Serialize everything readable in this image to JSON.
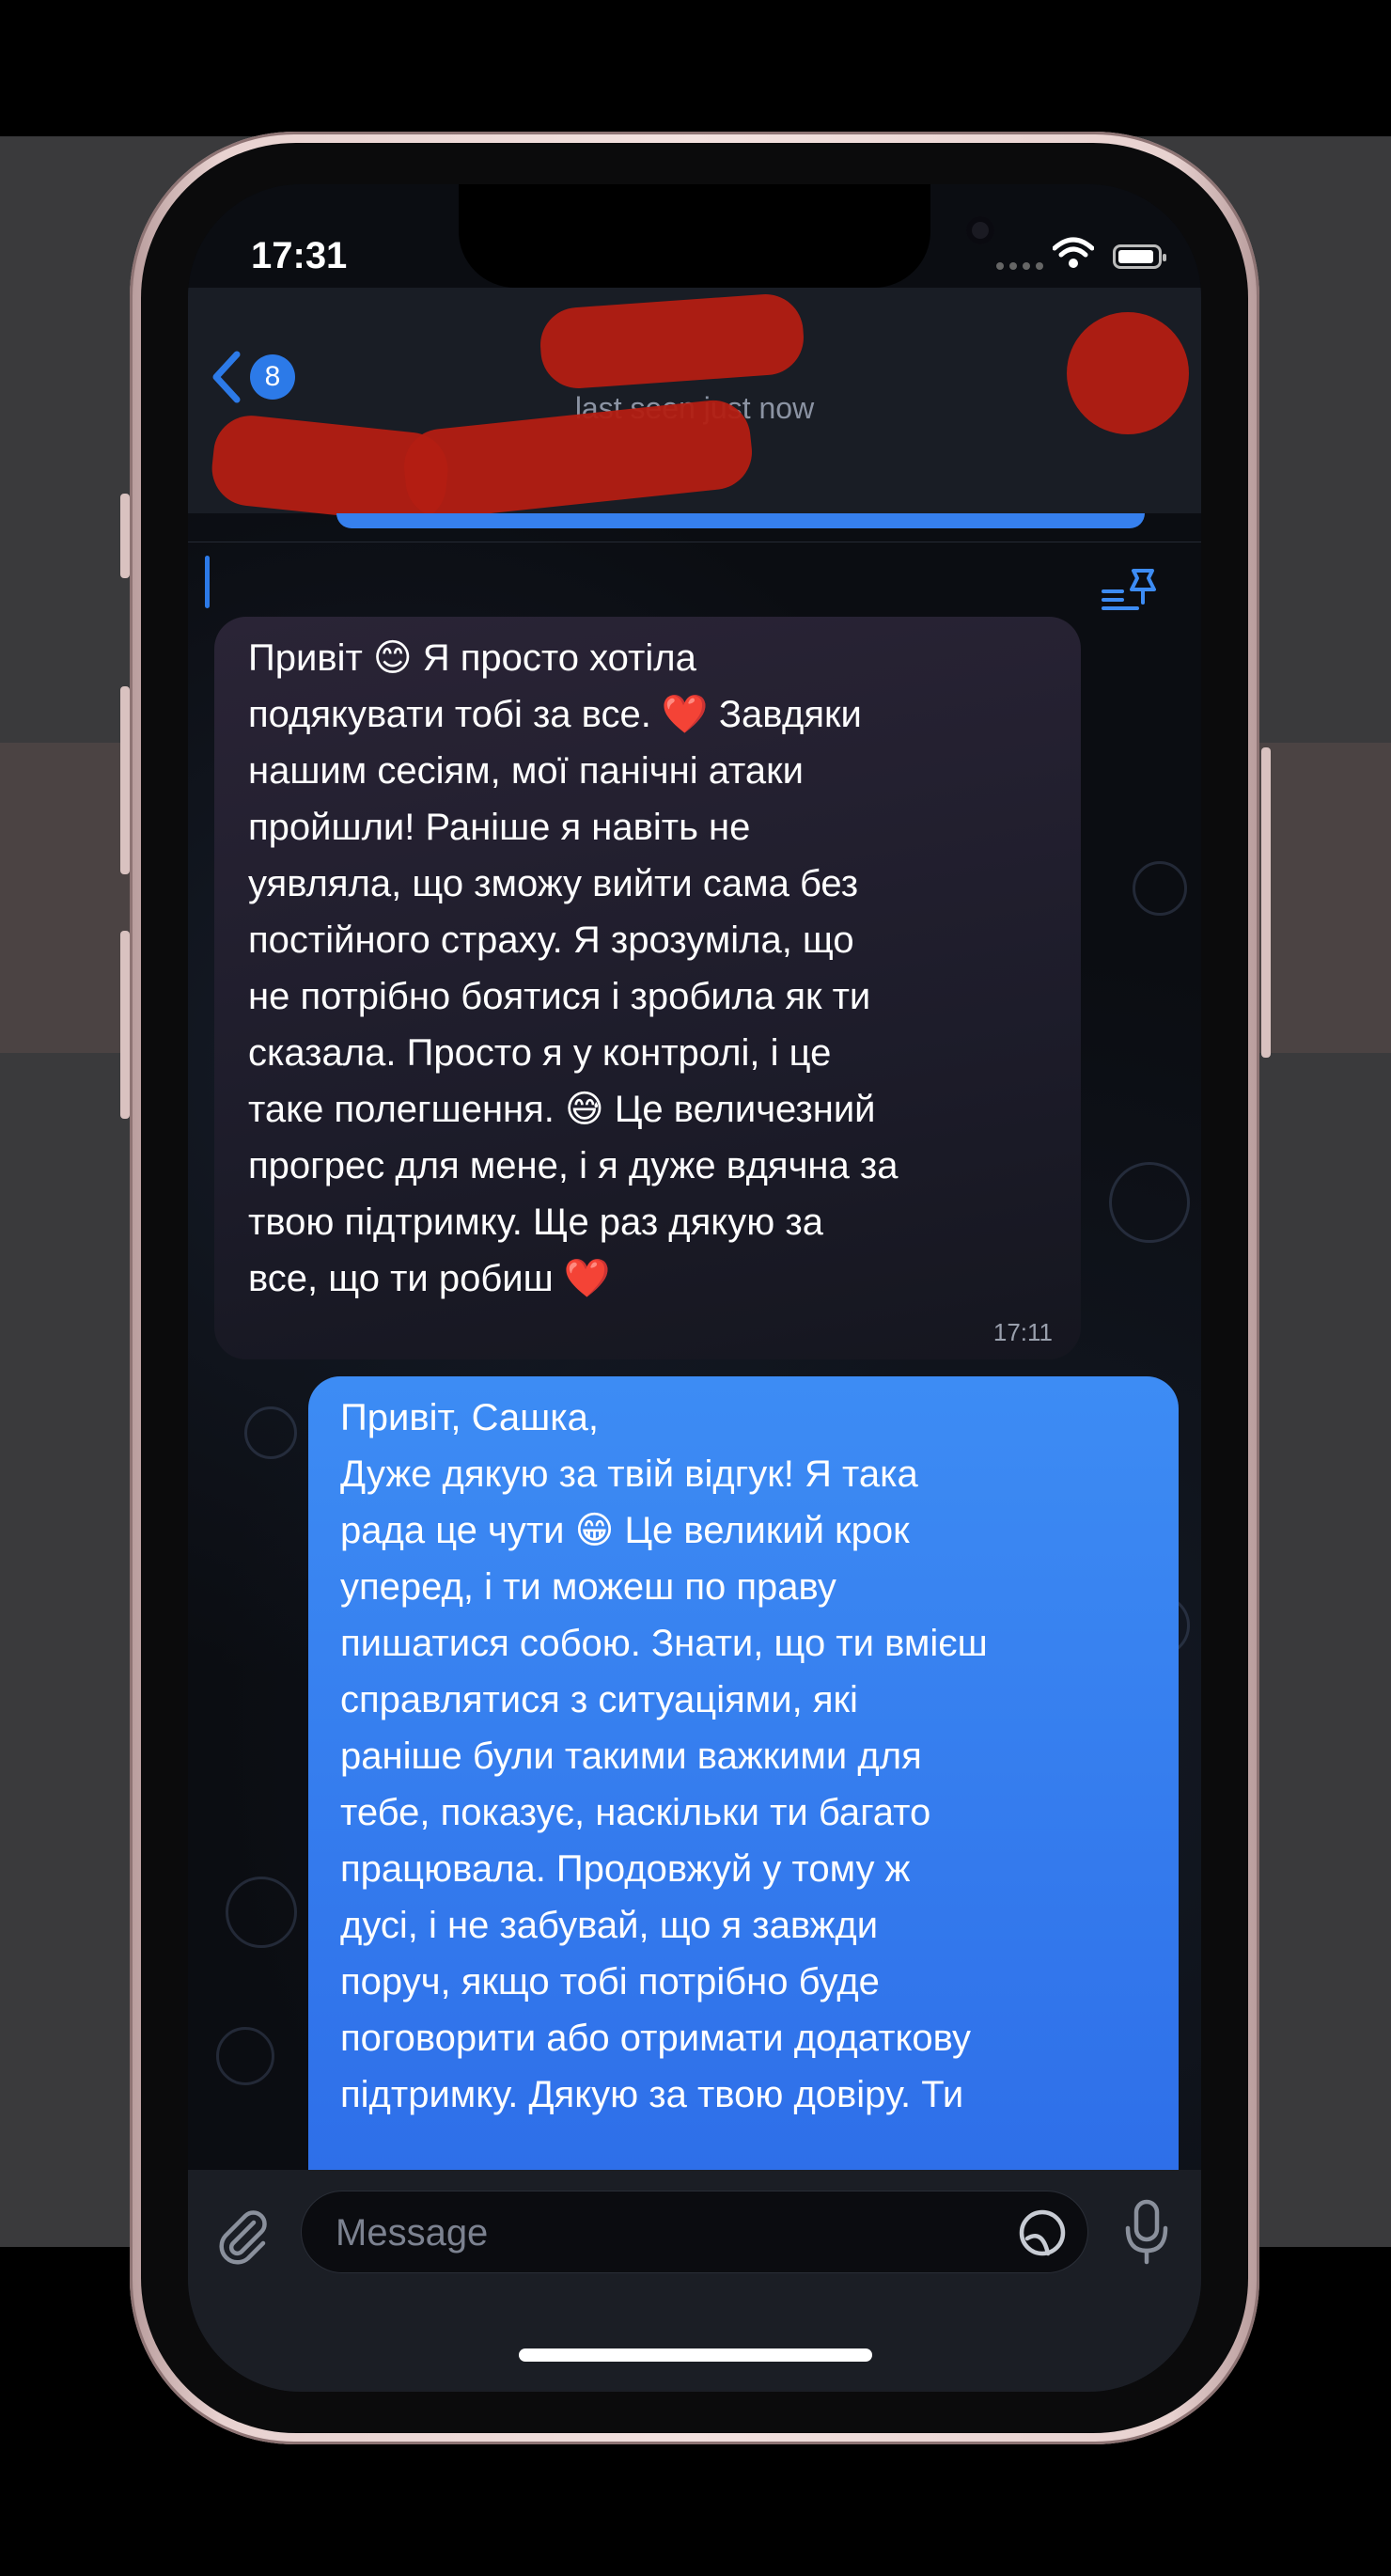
{
  "status_bar": {
    "time": "17:31"
  },
  "header": {
    "back_badge": "8",
    "subtitle": "last seen just now"
  },
  "messages": {
    "incoming": {
      "text": "Привіт 😊 Я просто хотіла\nподякувати тобі за все. ❤️ Завдяки\nнашим сесіям, мої панічні атаки\nпройшли! Раніше я навіть не\nуявляла, що зможу вийти сама без\nпостійного страху. Я зрозуміла, що\nне потрібно боятися і зробила як ти\nсказала. Просто я у контролі, і це\nтаке полегшення. 😅 Це величезний\nпрогрес для мене, і я дуже вдячна за\nтвою підтримку. Ще раз дякую за\nвсе, що ти робиш ❤️",
      "time": "17:11"
    },
    "outgoing": {
      "text": "Привіт, Сашка,\nДуже дякую за твій відгук! Я така\nрада це чути 😁 Це великий крок\nуперед, і ти можеш по праву\nпишатися собою. Знати, що ти вмієш\nсправлятися з ситуаціями, які\nраніше були такими важкими для\nтебе, показує, наскільки ти багато\nпрацювала. Продовжуй у тому ж\nдусі, і не забувай, що я завжди\nпоруч, якщо тобі потрібно буде\nпоговорити або отримати додаткову\nпідтримку. Дякую за твою довіру. Ти"
    }
  },
  "composer": {
    "placeholder": "Message"
  },
  "icons": {
    "back": "chevron-left-icon",
    "pinned": "pinned-list-icon",
    "attach": "paperclip-icon",
    "sticker": "sticker-icon",
    "mic": "microphone-icon",
    "wifi": "wifi-icon",
    "battery": "battery-icon"
  },
  "colors": {
    "accent": "#2c7ae8",
    "outgoing_bubble": "#3d8cf4",
    "incoming_bubble": "#2a2436",
    "redaction": "#b31d12"
  }
}
